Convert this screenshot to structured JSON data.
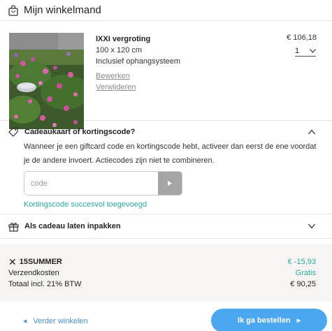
{
  "header": {
    "title": "Mijn winkelmand"
  },
  "item": {
    "name": "IXXI vergroting",
    "dimensions": "100 x 120 cm",
    "system": "Inclusief ophangsysteem",
    "edit_label": "Bewerken",
    "remove_label": "Verwijderen",
    "price": "€ 106,18",
    "quantity": "1"
  },
  "voucher": {
    "title": "Cadeaukaart of kortingscode?",
    "description": "Wanneer je een giftcard code en kortingscode hebt, activeer dan eerst de ene voordat je de andere invoert. Actiecodes zijn niet te combineren.",
    "placeholder": "code",
    "success": "Kortingscode succesvol toegevoegd"
  },
  "gift": {
    "label": "Als cadeau laten inpakken"
  },
  "summary": {
    "discount_code": "15SUMMER",
    "discount_value": "€ -15,93",
    "shipping_label": "Verzendkosten",
    "shipping_value": "Gratis",
    "total_label": "Totaal incl. 21% BTW",
    "total_value": "€ 90,25"
  },
  "footer": {
    "back_label": "Verder winkelen",
    "order_label": "Ik ga bestellen"
  },
  "colors": {
    "accent_teal": "#2baa9d",
    "accent_blue": "#4aa7f0",
    "link_blue": "#4a8fd6"
  }
}
